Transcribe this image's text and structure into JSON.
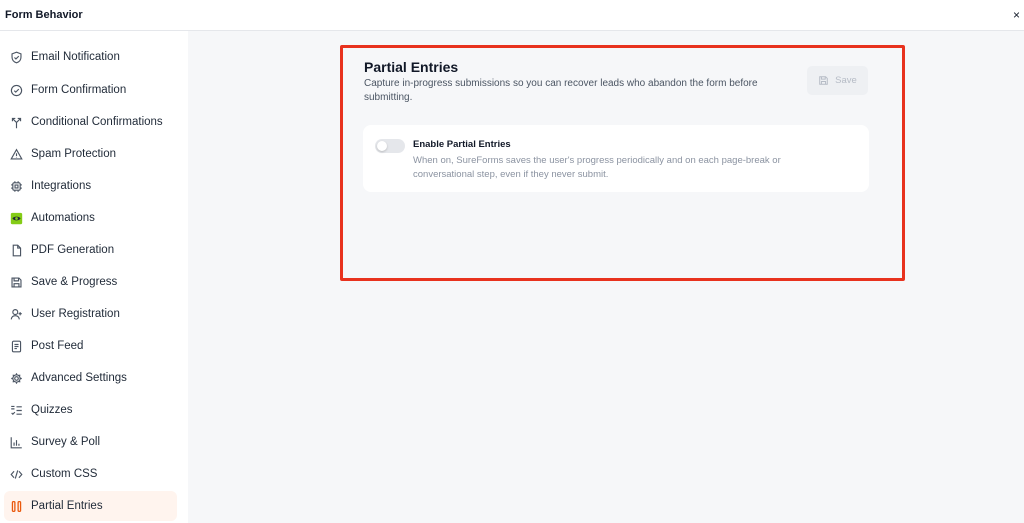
{
  "header": {
    "title": "Form Behavior",
    "close_glyph": "×"
  },
  "sidebar": {
    "items": [
      {
        "label": "Email Notification",
        "icon": "shield-check-icon"
      },
      {
        "label": "Form Confirmation",
        "icon": "check-circle-icon"
      },
      {
        "label": "Conditional Confirmations",
        "icon": "split-arrows-icon"
      },
      {
        "label": "Spam Protection",
        "icon": "warning-triangle-icon"
      },
      {
        "label": "Integrations",
        "icon": "chip-icon"
      },
      {
        "label": "Automations",
        "icon": "automations-icon"
      },
      {
        "label": "PDF Generation",
        "icon": "file-icon"
      },
      {
        "label": "Save & Progress",
        "icon": "save-icon"
      },
      {
        "label": "User Registration",
        "icon": "user-plus-icon"
      },
      {
        "label": "Post Feed",
        "icon": "document-icon"
      },
      {
        "label": "Advanced Settings",
        "icon": "gear-icon"
      },
      {
        "label": "Quizzes",
        "icon": "list-check-icon"
      },
      {
        "label": "Survey & Poll",
        "icon": "bar-chart-icon"
      },
      {
        "label": "Custom CSS",
        "icon": "code-icon"
      },
      {
        "label": "Partial Entries",
        "icon": "partial-entries-icon",
        "active": true
      }
    ]
  },
  "main": {
    "title": "Partial Entries",
    "description": "Capture in-progress submissions so you can recover leads who abandon the form before submitting.",
    "save_label": "Save",
    "setting": {
      "label": "Enable Partial Entries",
      "description": "When on, SureForms saves the user's progress periodically and on each page-break or conversational step, even if they never submit.",
      "enabled": false
    }
  },
  "colors": {
    "accent": "#ea580c",
    "active_bg": "#fff4ee",
    "highlight_border": "#e8321e",
    "automations_icon": "#84cc16"
  }
}
